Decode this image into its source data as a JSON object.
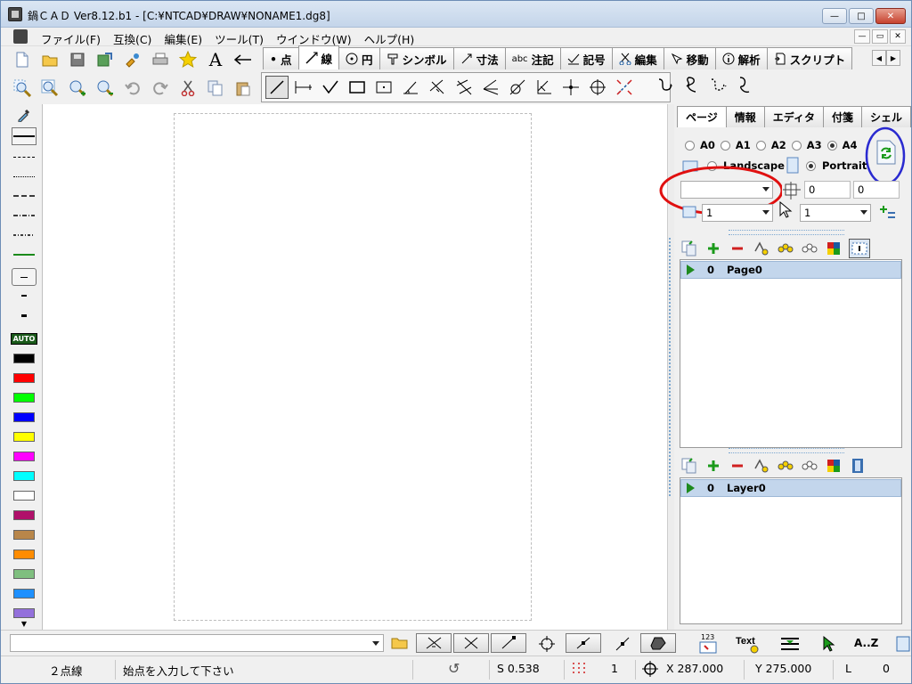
{
  "window": {
    "title": "鍋ＣＡＤ Ver8.12.b1 - [C:¥NTCAD¥DRAW¥NONAME1.dg8]",
    "min_label": "—",
    "max_label": "□",
    "close_label": "✕"
  },
  "menu": {
    "items": [
      "ファイル(F)",
      "互換(C)",
      "編集(E)",
      "ツール(T)",
      "ウインドウ(W)",
      "ヘルプ(H)"
    ]
  },
  "mdi": {
    "min": "—",
    "restore": "▭",
    "close": "✕"
  },
  "tool_tabs": [
    {
      "label": "点",
      "icon": "dot-icon"
    },
    {
      "label": "線",
      "icon": "line-icon",
      "active": true
    },
    {
      "label": "円",
      "icon": "circle-icon"
    },
    {
      "label": "シンボル",
      "icon": "symbol-icon"
    },
    {
      "label": "寸法",
      "icon": "dimension-icon"
    },
    {
      "label": "注記",
      "icon": "abc-icon",
      "prefix": "abc"
    },
    {
      "label": "記号",
      "icon": "check-icon"
    },
    {
      "label": "編集",
      "icon": "scissors-icon"
    },
    {
      "label": "移動",
      "icon": "move-icon"
    },
    {
      "label": "解析",
      "icon": "info-icon"
    },
    {
      "label": "スクリプト",
      "icon": "script-icon"
    }
  ],
  "tabs_scroll": {
    "left": "◀",
    "right": "▶"
  },
  "standard_toolbar_icons": [
    "new-file-icon",
    "open-folder-icon",
    "save-icon",
    "save-as-icon",
    "settings-icon",
    "print-icon",
    "favorite-star-icon",
    "text-icon",
    "arrow-left-icon"
  ],
  "view_toolbar_icons": [
    "zoom-window-icon",
    "zoom-fit-icon",
    "zoom-in-icon",
    "zoom-out-icon",
    "undo-icon",
    "redo-icon",
    "cut-icon",
    "copy-icon",
    "paste-icon"
  ],
  "left_palette": {
    "auto_label": "AUTO",
    "colors": [
      "#000000",
      "#ff0000",
      "#00ff00",
      "#0000ff",
      "#ffff00",
      "#ff00ff",
      "#00ffff",
      "#ffffff",
      "#b0106a",
      "#b8864a",
      "#ff8c00",
      "#7fbf7f",
      "#1e90ff",
      "#9370db"
    ],
    "green_line": "#1a8a1a"
  },
  "panel": {
    "tabs": [
      "ページ",
      "情報",
      "エディタ",
      "付箋",
      "シェル"
    ],
    "paper_sizes": [
      {
        "label": "A0",
        "selected": false
      },
      {
        "label": "A1",
        "selected": false
      },
      {
        "label": "A2",
        "selected": false
      },
      {
        "label": "A3",
        "selected": false
      },
      {
        "label": "A4",
        "selected": true
      }
    ],
    "orientation": {
      "landscape": "Landscape",
      "portrait": "Portrait",
      "selected": "Portrait"
    },
    "origin_x": "0",
    "origin_y": "0",
    "scale_left": "1",
    "scale_right": "1",
    "page_row": {
      "index": "0",
      "name": "Page0"
    },
    "layer_row": {
      "index": "0",
      "name": "Layer0"
    }
  },
  "bottom_toolbar": {
    "text_label": "Text",
    "az_label": "A..Z",
    "num_label": "123"
  },
  "status": {
    "mode": "２点線",
    "prompt": "始点を入力して下さい",
    "scale": "S 0.538",
    "grid": "1",
    "x": "X 287.000",
    "y": "Y 275.000",
    "layer": "L",
    "layer_value": "0"
  },
  "colors": {
    "title_gradient_top": "#dbe6f3",
    "selection_blue": "#c3d6ec",
    "annotation_red": "#e01010",
    "annotation_blue": "#2a2ad0"
  }
}
